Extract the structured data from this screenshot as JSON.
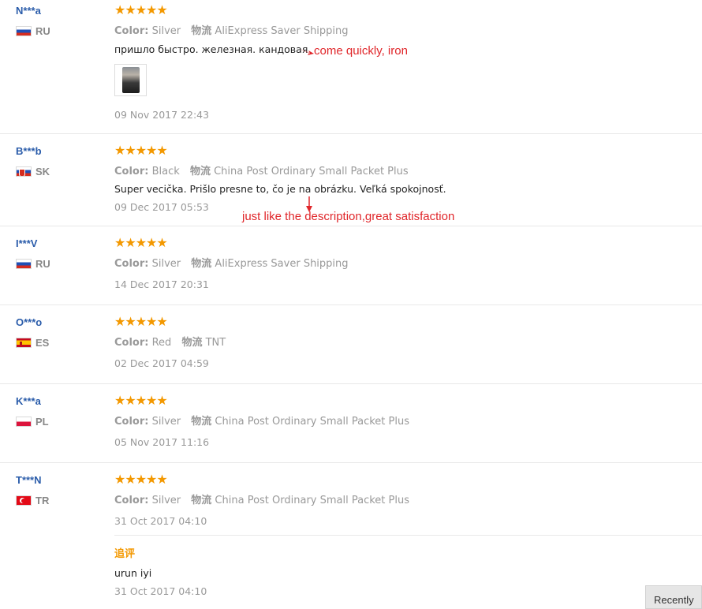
{
  "reviews": [
    {
      "user": "N***a",
      "country": "RU",
      "stars": "★★★★★",
      "color_label": "Color:",
      "color_value": "Silver",
      "shipping_label": "物流",
      "shipping_value": "AliExpress Saver Shipping",
      "text": "пришло быстро. железная. кандовая",
      "date": "09 Nov 2017 22:43"
    },
    {
      "user": "B***b",
      "country": "SK",
      "stars": "★★★★★",
      "color_label": "Color:",
      "color_value": "Black",
      "shipping_label": "物流",
      "shipping_value": "China Post Ordinary Small Packet Plus",
      "text": "Super vecička. Prišlo presne to, čo je na obrázku. Veľká spokojnosť.",
      "date": "09 Dec 2017 05:53"
    },
    {
      "user": "I***V",
      "country": "RU",
      "stars": "★★★★★",
      "color_label": "Color:",
      "color_value": "Silver",
      "shipping_label": "物流",
      "shipping_value": "AliExpress Saver Shipping",
      "date": "14 Dec 2017 20:31"
    },
    {
      "user": "O***o",
      "country": "ES",
      "stars": "★★★★★",
      "color_label": "Color:",
      "color_value": "Red",
      "shipping_label": "物流",
      "shipping_value": "TNT",
      "date": "02 Dec 2017 04:59"
    },
    {
      "user": "K***a",
      "country": "PL",
      "stars": "★★★★★",
      "color_label": "Color:",
      "color_value": "Silver",
      "shipping_label": "物流",
      "shipping_value": "China Post Ordinary Small Packet Plus",
      "date": "05 Nov 2017 11:16"
    },
    {
      "user": "T***N",
      "country": "TR",
      "stars": "★★★★★",
      "color_label": "Color:",
      "color_value": "Silver",
      "shipping_label": "物流",
      "shipping_value": "China Post Ordinary Small Packet Plus",
      "date": "31 Oct 2017 04:10",
      "followup_label": "追评",
      "followup_text": "urun iyi",
      "followup_date": "31 Oct 2017 04:10"
    }
  ],
  "annotations": {
    "first": "come quickly, iron",
    "second": "just like the description,great satisfaction"
  },
  "recent_tab": "Recently",
  "colors": {
    "star": "#f39800",
    "username": "#2a5caa",
    "annotation": "#e0262a",
    "meta": "#999999"
  }
}
